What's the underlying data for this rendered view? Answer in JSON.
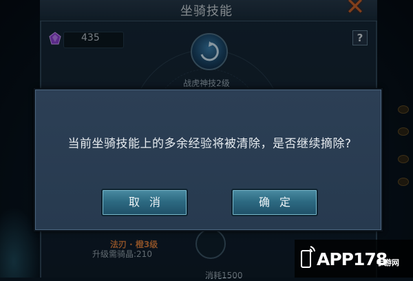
{
  "background": {
    "title": "坐骑技能",
    "currency_value": "435",
    "help_label": "?",
    "close_label": "✕",
    "skill_name": "战虎神技2级",
    "bottom_skill_line1": "法刃 · 橙3级",
    "bottom_skill_line2": "升级需骑晶:210",
    "bottom_cost": "消耗1500"
  },
  "dialog": {
    "message": "当前坐骑技能上的多余经验将被清除，是否继续摘除?",
    "cancel_label": "取消",
    "confirm_label": "确定"
  },
  "watermark": {
    "text": "APP178",
    "sub": "手游网"
  },
  "colors": {
    "dialog_bg": "#2c3f55",
    "button": "#2d6a82",
    "close_accent": "#c5622c",
    "skill_orange": "#d27a3d"
  }
}
